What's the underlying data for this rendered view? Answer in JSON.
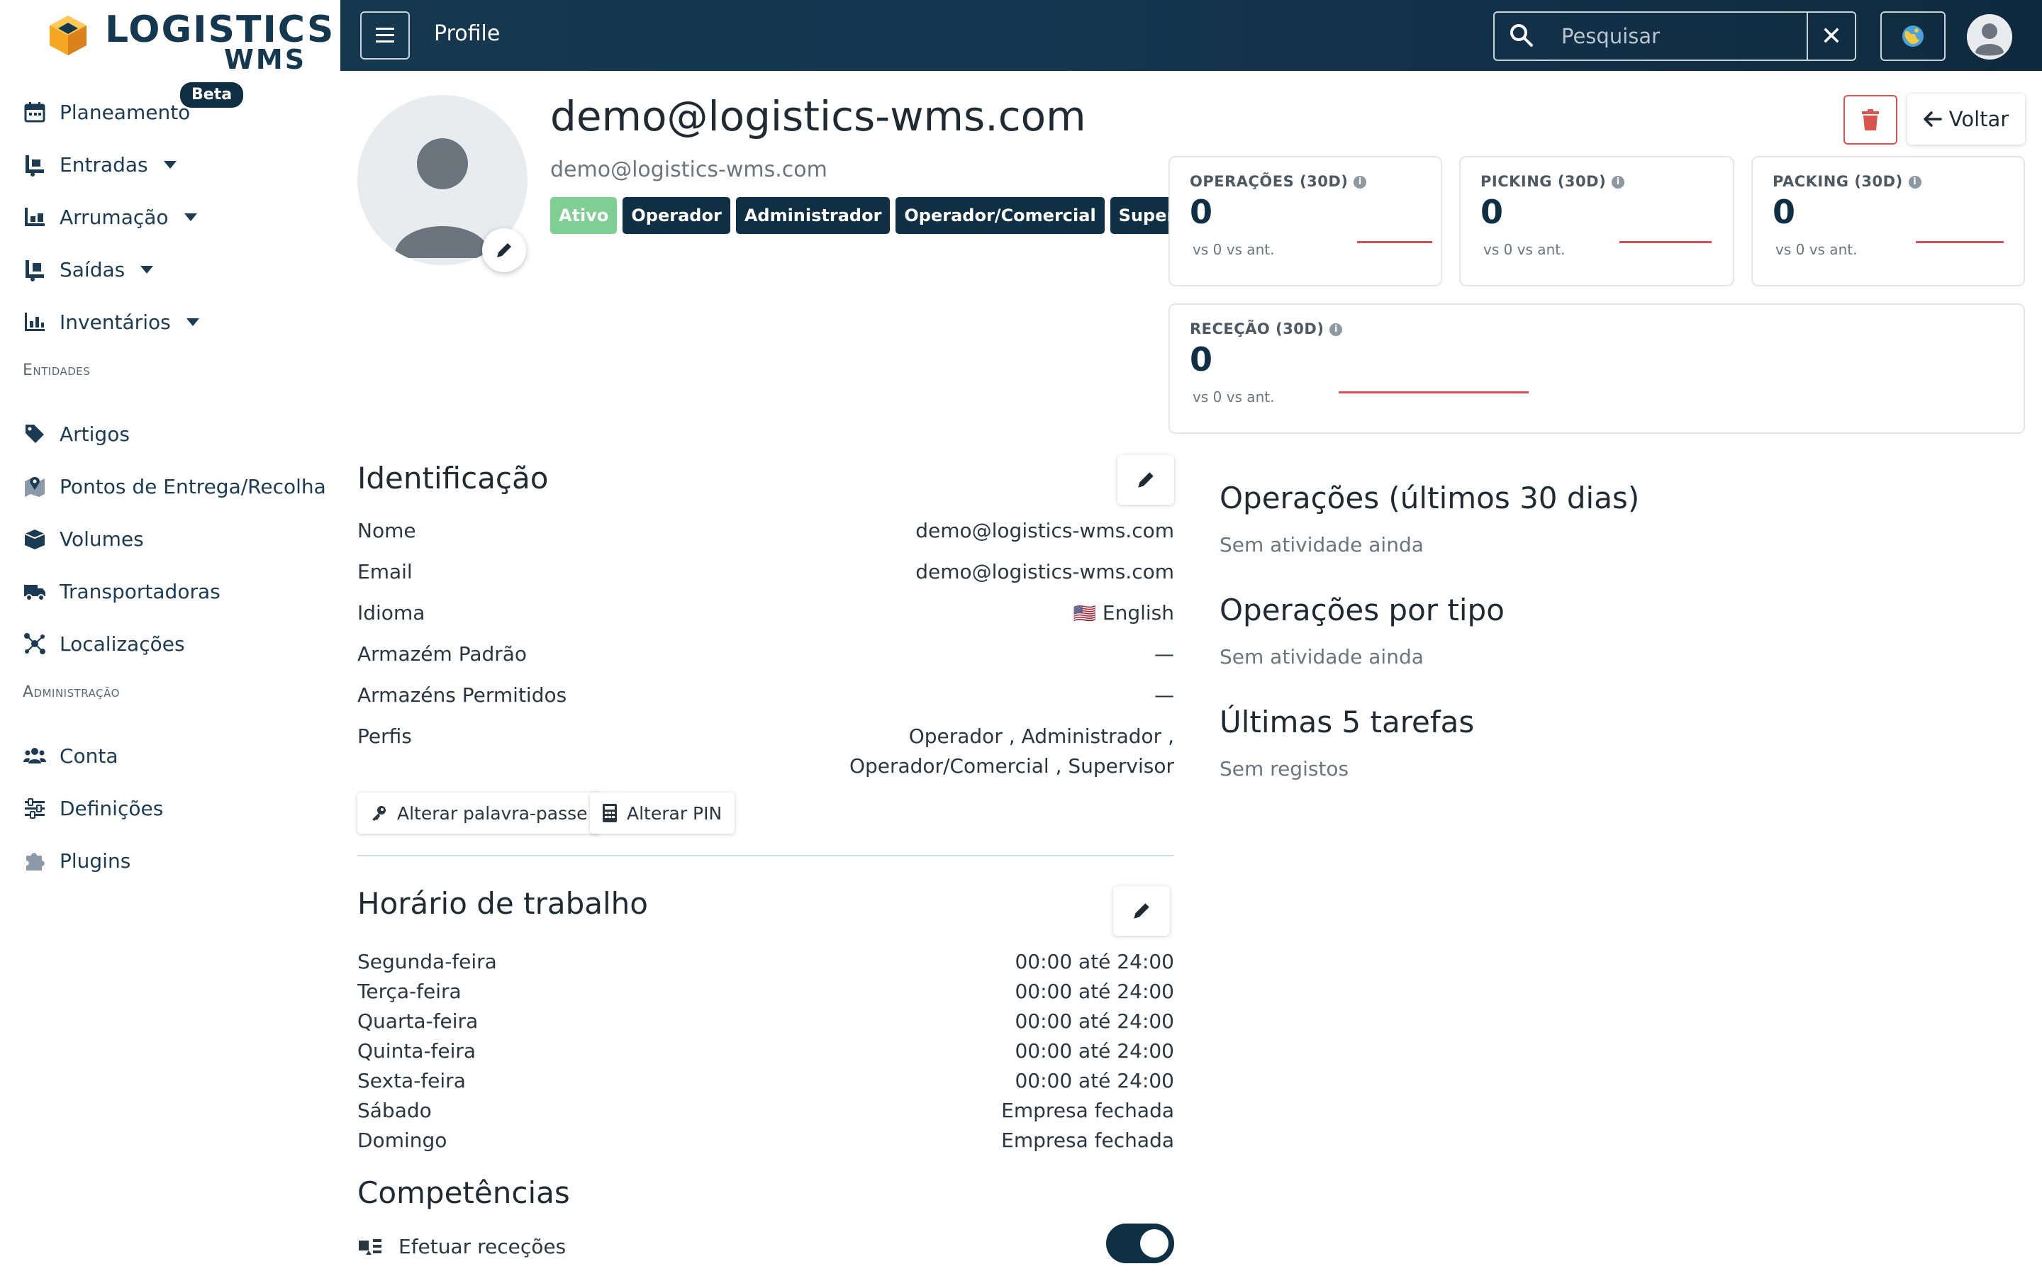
{
  "app": {
    "logo_title": "LOGISTICS",
    "logo_subtitle": "WMS",
    "brand_color": "#14384f",
    "accent_color": "#f5a623"
  },
  "sidebar": {
    "items": [
      {
        "label": "Planeamento",
        "icon": "calendar-icon",
        "badge": "Beta"
      },
      {
        "label": "Entradas",
        "icon": "inbound-icon",
        "has_dropdown": true
      },
      {
        "label": "Arrumação",
        "icon": "shelving-icon",
        "has_dropdown": true
      },
      {
        "label": "Saídas",
        "icon": "outbound-icon",
        "has_dropdown": true
      },
      {
        "label": "Inventários",
        "icon": "inventory-icon",
        "has_dropdown": true
      }
    ],
    "entities_section": "Entidades",
    "entities": [
      {
        "label": "Artigos",
        "icon": "tags-icon"
      },
      {
        "label": "Pontos de Entrega/Recolha",
        "icon": "map-pin-icon"
      },
      {
        "label": "Volumes",
        "icon": "box-icon"
      },
      {
        "label": "Transportadoras",
        "icon": "truck-icon"
      },
      {
        "label": "Localizações",
        "icon": "network-icon"
      }
    ],
    "admin_section": "Administração",
    "admin": [
      {
        "label": "Conta",
        "icon": "users-icon"
      },
      {
        "label": "Definições",
        "icon": "sliders-icon"
      },
      {
        "label": "Plugins",
        "icon": "puzzle-icon"
      }
    ]
  },
  "topbar": {
    "title": "Profile",
    "search_placeholder": "Pesquisar",
    "clear_label": "✕"
  },
  "profile": {
    "email_title": "demo@logistics-wms.com",
    "email_sub": "demo@logistics-wms.com",
    "badges": [
      {
        "label": "Ativo",
        "color": "#7fcf95"
      },
      {
        "label": "Operador",
        "color": "#0f2f45"
      },
      {
        "label": "Administrador",
        "color": "#0f2f45"
      },
      {
        "label": "Operador/Comercial",
        "color": "#0f2f45"
      },
      {
        "label": "Supervisor",
        "color": "#0f2f45"
      }
    ],
    "back_label": "Voltar"
  },
  "kpis": [
    {
      "label": "OPERAÇÕES (30D)",
      "value": "0",
      "sub": "vs 0 vs ant."
    },
    {
      "label": "PICKING (30D)",
      "value": "0",
      "sub": "vs 0 vs ant."
    },
    {
      "label": "PACKING (30D)",
      "value": "0",
      "sub": "vs 0 vs ant."
    },
    {
      "label": "RECEÇÃO (30D)",
      "value": "0",
      "sub": "vs 0 vs ant."
    }
  ],
  "identification": {
    "title": "Identificação",
    "rows": [
      {
        "label": "Nome",
        "value": "demo@logistics-wms.com"
      },
      {
        "label": "Email",
        "value": "demo@logistics-wms.com"
      },
      {
        "label": "Idioma",
        "value": "English",
        "flag": "🇺🇸"
      },
      {
        "label": "Armazém Padrão",
        "value": "—"
      },
      {
        "label": "Armazéns Permitidos",
        "value": "—"
      },
      {
        "label": "Perfis",
        "value_line1": "Operador , Administrador ,",
        "value_line2": "Operador/Comercial , Supervisor"
      }
    ],
    "change_password": "Alterar palavra-passe",
    "change_pin": "Alterar PIN"
  },
  "schedule": {
    "title": "Horário de trabalho",
    "days": [
      {
        "day": "Segunda-feira",
        "hours": "00:00 até 24:00"
      },
      {
        "day": "Terça-feira",
        "hours": "00:00 até 24:00"
      },
      {
        "day": "Quarta-feira",
        "hours": "00:00 até 24:00"
      },
      {
        "day": "Quinta-feira",
        "hours": "00:00 até 24:00"
      },
      {
        "day": "Sexta-feira",
        "hours": "00:00 até 24:00"
      },
      {
        "day": "Sábado",
        "hours": "Empresa fechada"
      },
      {
        "day": "Domingo",
        "hours": "Empresa fechada"
      }
    ]
  },
  "competences": {
    "title": "Competências",
    "items": [
      {
        "label": "Efetuar receções",
        "enabled": true
      }
    ]
  },
  "right": {
    "ops_title": "Operações (últimos 30 dias)",
    "ops_empty": "Sem atividade ainda",
    "ops_type_title": "Operações por tipo",
    "ops_type_empty": "Sem atividade ainda",
    "tasks_title": "Últimas 5 tarefas",
    "tasks_empty": "Sem registos"
  }
}
